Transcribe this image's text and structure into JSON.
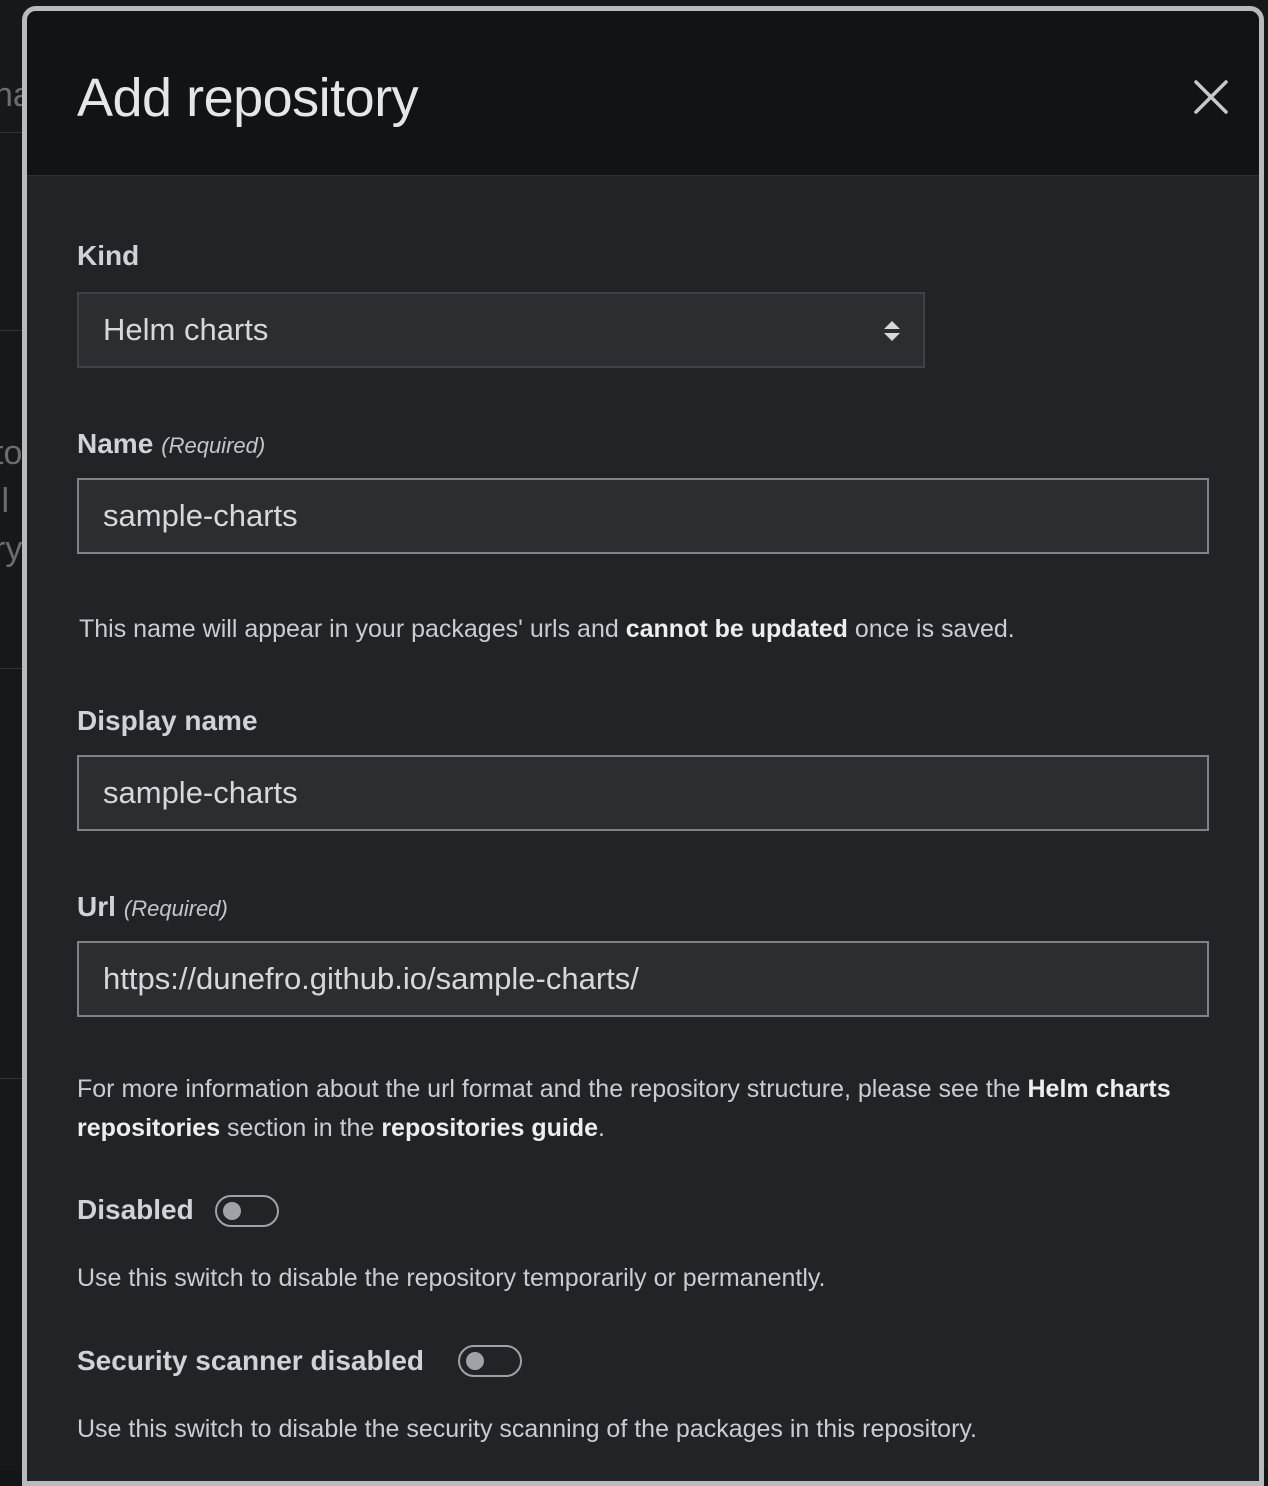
{
  "modal": {
    "title": "Add repository",
    "close_label": "close"
  },
  "kind": {
    "label": "Kind",
    "selected": "Helm charts"
  },
  "name": {
    "label": "Name",
    "required": "(Required)",
    "value": "sample-charts",
    "help_prefix": "This name will appear in your packages' urls and ",
    "help_bold": "cannot be updated",
    "help_suffix": " once is saved."
  },
  "display_name": {
    "label": "Display name",
    "value": "sample-charts"
  },
  "url": {
    "label": "Url",
    "required": "(Required)",
    "value": "https://dunefro.github.io/sample-charts/",
    "help_prefix": "For more information about the url format and the repository structure, please see the ",
    "help_link1": "Helm charts repositories",
    "help_mid": " section in the ",
    "help_link2": "repositories guide",
    "help_suffix": "."
  },
  "disabled": {
    "label": "Disabled",
    "on": false,
    "help": "Use this switch to disable the repository temporarily or permanently."
  },
  "scanner": {
    "label": "Security scanner disabled",
    "on": false,
    "help": "Use this switch to disable the security scanning of the packages in this repository."
  },
  "background_fragments": [
    "na",
    "to",
    "ll",
    "ry"
  ]
}
